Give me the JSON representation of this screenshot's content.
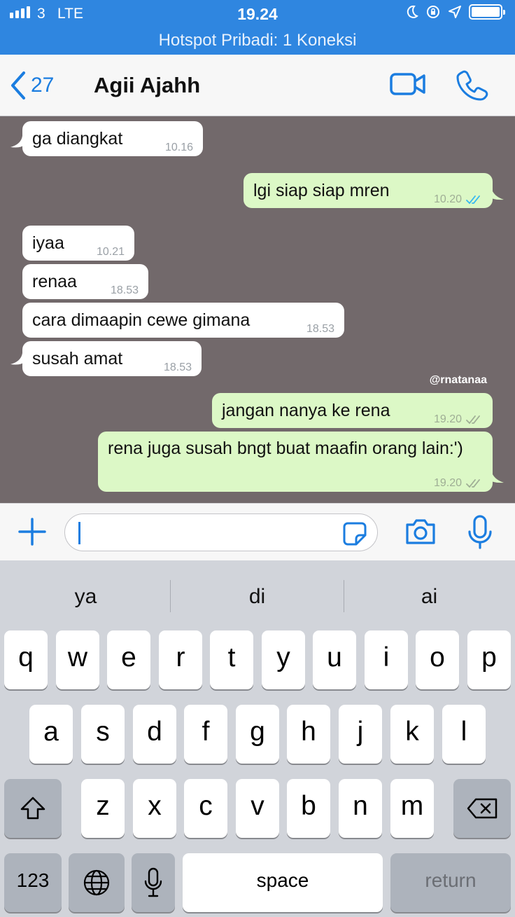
{
  "status_bar": {
    "carrier": "3",
    "network": "LTE",
    "time": "19.24",
    "icons": [
      "signal-bars-icon",
      "moon-icon",
      "rotation-lock-icon",
      "location-arrow-icon",
      "battery-icon"
    ],
    "color": "#2f86e0"
  },
  "hotspot_banner": "Hotspot Pribadi: 1 Koneksi",
  "header": {
    "back_count": "27",
    "contact_name": "Agii Ajahh",
    "icons": [
      "chevron-left-icon",
      "video-call-icon",
      "phone-call-icon"
    ],
    "accent": "#1b7de0"
  },
  "messages": [
    {
      "dir": "in",
      "text": "ga diangkat",
      "time": "10.16"
    },
    {
      "dir": "out",
      "text": "lgi siap siap mren",
      "time": "10.20",
      "status": "read"
    },
    {
      "dir": "in",
      "text": "iyaa",
      "time": "10.21"
    },
    {
      "dir": "in",
      "text": "renaa",
      "time": "18.53"
    },
    {
      "dir": "in",
      "text": "cara dimaapin cewe gimana",
      "time": "18.53"
    },
    {
      "dir": "in",
      "text": "susah amat",
      "time": "18.53"
    },
    {
      "dir": "out",
      "text": "jangan nanya ke rena",
      "time": "19.20",
      "status": "delivered"
    },
    {
      "dir": "out",
      "text": "rena juga susah bngt buat maafin orang lain:')",
      "time": "19.20",
      "status": "delivered"
    }
  ],
  "watermark": "@rnatanaa",
  "colors": {
    "chat_bg": "#72696b",
    "incoming": "#ffffff",
    "outgoing": "#dcf8c6",
    "read_tick": "#34b7f1"
  },
  "input_bar": {
    "text": "",
    "icons": [
      "plus-icon",
      "sticker-icon",
      "camera-icon",
      "microphone-icon"
    ]
  },
  "keyboard": {
    "suggestions": [
      "ya",
      "di",
      "ai"
    ],
    "row1": [
      "q",
      "w",
      "e",
      "r",
      "t",
      "y",
      "u",
      "i",
      "o",
      "p"
    ],
    "row2": [
      "a",
      "s",
      "d",
      "f",
      "g",
      "h",
      "j",
      "k",
      "l"
    ],
    "row3": [
      "z",
      "x",
      "c",
      "v",
      "b",
      "n",
      "m"
    ],
    "numbers_key": "123",
    "space_key": "space",
    "return_key": "return",
    "icons": [
      "shift-icon",
      "backspace-icon",
      "globe-icon",
      "dictation-mic-icon"
    ]
  }
}
